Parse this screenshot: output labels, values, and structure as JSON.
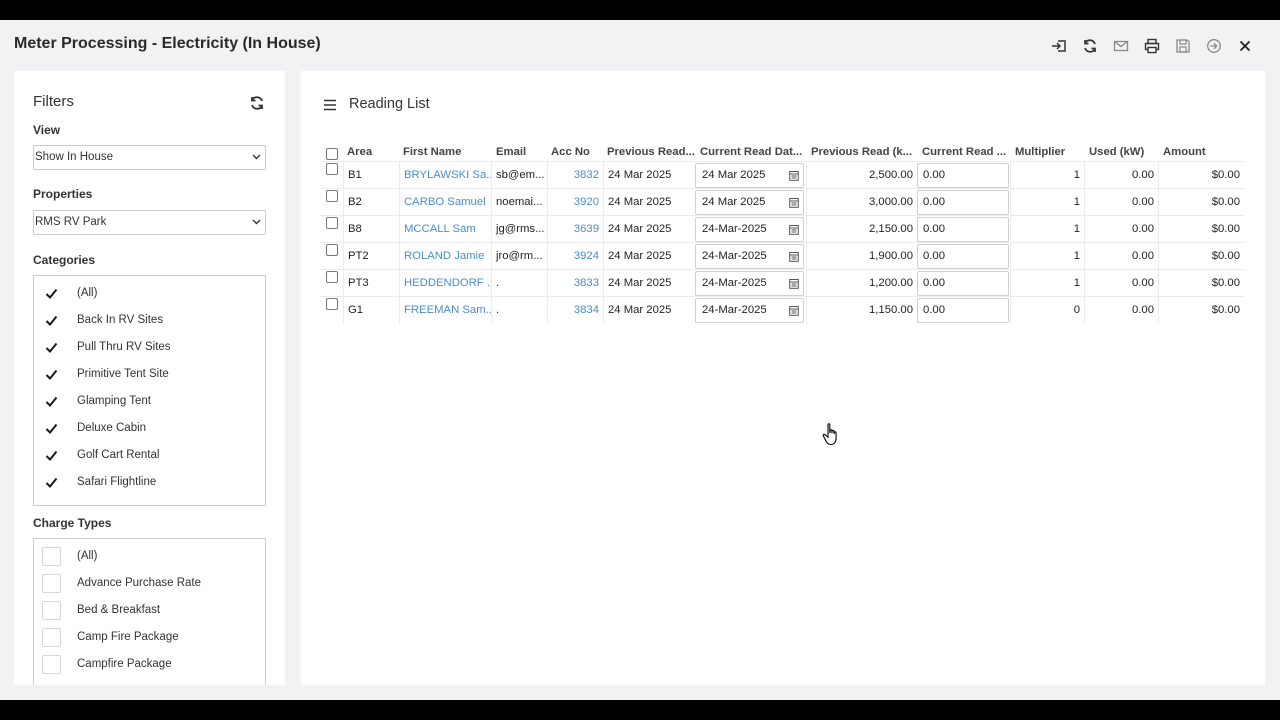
{
  "window": {
    "title": "Meter Processing - Electricity (In House)",
    "toolbar": [
      "import-icon",
      "refresh-icon",
      "email-icon",
      "print-icon",
      "save-icon",
      "forward-icon",
      "close-icon"
    ]
  },
  "filters": {
    "title": "Filters",
    "view_label": "View",
    "view_value": "Show In House",
    "properties_label": "Properties",
    "properties_value": "RMS RV Park",
    "categories_label": "Categories",
    "categories": [
      {
        "label": "(All)",
        "checked": true
      },
      {
        "label": "Back In RV Sites",
        "checked": true
      },
      {
        "label": "Pull Thru RV Sites",
        "checked": true
      },
      {
        "label": "Primitive Tent Site",
        "checked": true
      },
      {
        "label": "Glamping Tent",
        "checked": true
      },
      {
        "label": "Deluxe Cabin",
        "checked": true
      },
      {
        "label": "Golf Cart Rental",
        "checked": true
      },
      {
        "label": "Safari Flightline",
        "checked": true
      }
    ],
    "charge_types_label": "Charge Types",
    "charge_types": [
      {
        "label": "(All)",
        "checked": false
      },
      {
        "label": "Advance Purchase Rate",
        "checked": false
      },
      {
        "label": "Bed & Breakfast",
        "checked": false
      },
      {
        "label": "Camp Fire Package",
        "checked": false
      },
      {
        "label": "Campfire Package",
        "checked": false
      }
    ]
  },
  "reading_list": {
    "title": "Reading List",
    "columns": [
      "Area",
      "First Name",
      "Email",
      "Acc No",
      "Previous Read...",
      "Current Read Dat...",
      "Previous Read (k...",
      "Current Read ...",
      "Multiplier",
      "Used (kW)",
      "Amount"
    ],
    "rows": [
      {
        "area": "B1",
        "first_name": "BRYLAWSKI Sa...",
        "email": "sb@em...",
        "acc_no": "3832",
        "prev_date": "24 Mar 2025",
        "curr_date": "24 Mar 2025",
        "prev_read": "2,500.00",
        "curr_read": "0.00",
        "multiplier": "1",
        "used": "0.00",
        "amount": "$0.00"
      },
      {
        "area": "B2",
        "first_name": "CARBO Samuel",
        "email": "noemai...",
        "acc_no": "3920",
        "prev_date": "24 Mar 2025",
        "curr_date": "24 Mar 2025",
        "prev_read": "3,000.00",
        "curr_read": "0.00",
        "multiplier": "1",
        "used": "0.00",
        "amount": "$0.00"
      },
      {
        "area": "B8",
        "first_name": "MCCALL Sam",
        "email": "jg@rms...",
        "acc_no": "3639",
        "prev_date": "24 Mar 2025",
        "curr_date": "24-Mar-2025",
        "prev_read": "2,150.00",
        "curr_read": "0.00",
        "multiplier": "1",
        "used": "0.00",
        "amount": "$0.00"
      },
      {
        "area": "PT2",
        "first_name": "ROLAND Jamie",
        "email": "jro@rm...",
        "acc_no": "3924",
        "prev_date": "24 Mar 2025",
        "curr_date": "24-Mar-2025",
        "prev_read": "1,900.00",
        "curr_read": "0.00",
        "multiplier": "1",
        "used": "0.00",
        "amount": "$0.00"
      },
      {
        "area": "PT3",
        "first_name": "HEDDENDORF ...",
        "email": ".",
        "acc_no": "3833",
        "prev_date": "24 Mar 2025",
        "curr_date": "24-Mar-2025",
        "prev_read": "1,200.00",
        "curr_read": "0.00",
        "multiplier": "1",
        "used": "0.00",
        "amount": "$0.00"
      },
      {
        "area": "G1",
        "first_name": "FREEMAN Sam...",
        "email": ".",
        "acc_no": "3834",
        "prev_date": "24 Mar 2025",
        "curr_date": "24-Mar-2025",
        "prev_read": "1,150.00",
        "curr_read": "0.00",
        "multiplier": "0",
        "used": "0.00",
        "amount": "$0.00"
      }
    ]
  },
  "colors": {
    "link": "#4a8dc8",
    "check": "#1a1a1a",
    "panel": "#ffffff",
    "background": "#f2f2f4"
  }
}
